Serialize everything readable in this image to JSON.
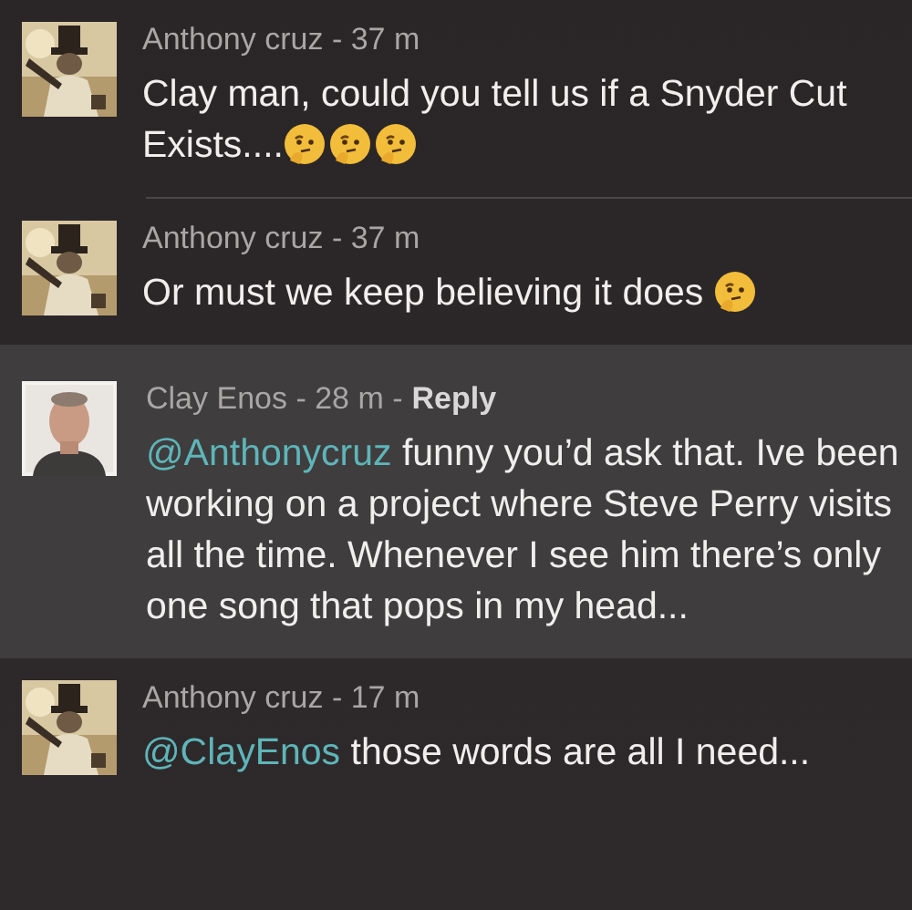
{
  "comments": [
    {
      "meta": "Anthony cruz - 37 m",
      "shaded": false,
      "divider": true,
      "body": [
        {
          "kind": "text",
          "text": "Clay man, could you tell us if a Snyder Cut Exists...."
        },
        {
          "kind": "emoji"
        },
        {
          "kind": "emoji"
        },
        {
          "kind": "emoji"
        }
      ]
    },
    {
      "meta": "Anthony cruz - 37 m",
      "shaded": false,
      "divider": false,
      "body": [
        {
          "kind": "text",
          "text": "Or must we keep believing it does "
        },
        {
          "kind": "emoji"
        }
      ]
    },
    {
      "meta": "Clay Enos - 28 m -",
      "reply": "Reply",
      "shaded": true,
      "divider": false,
      "body": [
        {
          "kind": "mention",
          "text": "@Anthonycruz"
        },
        {
          "kind": "text",
          "text": " funny you’d ask that. Ive been working on a project where Steve Perry visits all the time. Whenever I see him there’s only one song that pops in my head..."
        }
      ]
    },
    {
      "meta": "Anthony cruz - 17 m",
      "shaded": false,
      "divider": false,
      "body": [
        {
          "kind": "mention",
          "text": "@ClayEnos"
        },
        {
          "kind": "text",
          "text": " those words are all I need..."
        }
      ]
    }
  ]
}
